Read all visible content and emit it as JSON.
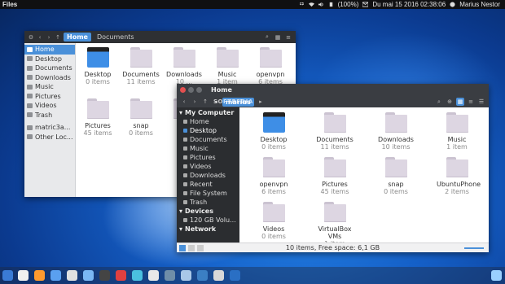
{
  "top_panel": {
    "app_name": "Files",
    "battery": "(100%)",
    "datetime": "Du mai 15 2016 02:38:06",
    "user": "Marius Nestor"
  },
  "window_back": {
    "path": [
      "Home",
      "Documents"
    ],
    "sidebar": [
      "Home",
      "Desktop",
      "Documents",
      "Downloads",
      "Music",
      "Pictures",
      "Videos",
      "Trash",
      "matric3a...",
      "Other Loc..."
    ],
    "items": [
      {
        "name": "Desktop",
        "sub": "0 items",
        "kind": "desktop"
      },
      {
        "name": "Documents",
        "sub": "11 items",
        "kind": "folder"
      },
      {
        "name": "Downloads",
        "sub": "10 ...",
        "kind": "folder"
      },
      {
        "name": "Music",
        "sub": "1 item",
        "kind": "folder"
      },
      {
        "name": "openvpn",
        "sub": "6 items",
        "kind": "folder"
      },
      {
        "name": "Pictures",
        "sub": "45 items",
        "kind": "folder"
      },
      {
        "name": "snap",
        "sub": "0 items",
        "kind": "folder"
      },
      {
        "name": "Ub...",
        "sub": "2 ...",
        "kind": "folder"
      }
    ]
  },
  "window_front": {
    "title": "Home",
    "path": [
      "marius"
    ],
    "sidebar": {
      "my_computer": "My Computer",
      "computer_items": [
        "Home",
        "Desktop",
        "Documents",
        "Music",
        "Pictures",
        "Videos",
        "Downloads",
        "Recent",
        "File System",
        "Trash"
      ],
      "devices": "Devices",
      "device_items": [
        "120 GB Volu..."
      ],
      "network": "Network"
    },
    "items": [
      {
        "name": "Desktop",
        "sub": "0 items",
        "kind": "desktop"
      },
      {
        "name": "Documents",
        "sub": "11 items",
        "kind": "folder"
      },
      {
        "name": "Downloads",
        "sub": "10 items",
        "kind": "folder"
      },
      {
        "name": "Music",
        "sub": "1 item",
        "kind": "folder"
      },
      {
        "name": "openvpn",
        "sub": "6 items",
        "kind": "folder"
      },
      {
        "name": "Pictures",
        "sub": "45 items",
        "kind": "folder"
      },
      {
        "name": "snap",
        "sub": "0 items",
        "kind": "folder"
      },
      {
        "name": "UbuntuPhone",
        "sub": "2 items",
        "kind": "folder"
      },
      {
        "name": "Videos",
        "sub": "0 items",
        "kind": "folder"
      },
      {
        "name": "VirtualBox VMs",
        "sub": "1 item",
        "kind": "folder"
      }
    ],
    "status": "10 items, Free space: 6,1 GB"
  },
  "watermark": "SOFTPEDIA",
  "dock": {
    "colors": [
      "#3a7bd5",
      "#f0f0f0",
      "#ff9a2e",
      "#5aa0f0",
      "#e0e0e0",
      "#7ab8f5",
      "#444444",
      "#e04040",
      "#4ac0e0",
      "#e8e8e8",
      "#6f8ea8",
      "#a9c8e8",
      "#3b7fc4",
      "#d8d8d8",
      "#2a6fc4",
      "#9ad0ff"
    ]
  }
}
